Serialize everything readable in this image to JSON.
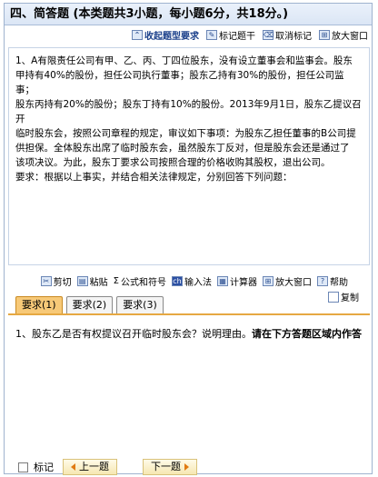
{
  "section_title": "四、简答题 (本类题共3小题，每小题6分，共18分。)",
  "top_toolbar": {
    "collapse": "收起题型要求",
    "mark_stem": "标记题干",
    "unmark": "取消标记",
    "zoom": "放大窗口"
  },
  "stem": {
    "lines": [
      "1、A有限责任公司有甲、乙、丙、丁四位股东，没有设立董事会和监事会。股东",
      "甲持有40%的股份，担任公司执行董事；股东乙持有30%的股份，担任公司监事；",
      "股东丙持有20%的股份；股东丁持有10%的股份。2013年9月1日，股东乙提议召开",
      "临时股东会，按照公司章程的规定，审议如下事项：为股东乙担任董事的B公司提",
      "供担保。全体股东出席了临时股东会，虽然股东丁反对，但是股东会还是通过了",
      "该项决议。为此，股东丁要求公司按照合理的价格收购其股权，退出公司。",
      "要求：根据以上事实，并结合相关法律规定，分别回答下列问题："
    ]
  },
  "edit_toolbar": {
    "cut": "剪切",
    "paste": "粘贴",
    "formula": "公式和符号",
    "input_method": "输入法",
    "calculator": "计算器",
    "zoom": "放大窗口",
    "help": "帮助",
    "copy": "复制"
  },
  "tabs": [
    "要求(1)",
    "要求(2)",
    "要求(3)"
  ],
  "question": {
    "text": "1、股东乙是否有权提议召开临时股东会？说明理由。",
    "instruction": "请在下方答题区域内作答"
  },
  "bottom": {
    "mark_label": "标记",
    "prev": "上一题",
    "next": "下一题"
  }
}
